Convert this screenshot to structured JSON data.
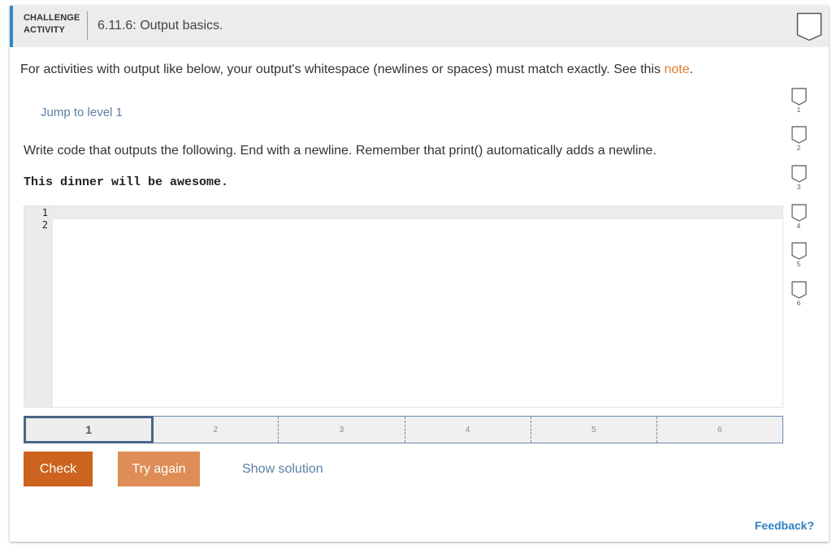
{
  "header": {
    "activity_type_line1": "CHALLENGE",
    "activity_type_line2": "ACTIVITY",
    "title": "6.11.6: Output basics.",
    "completion_badge_icon": "shield-outline-icon"
  },
  "instructions": {
    "text": "For activities with output like below, your output's whitespace (newlines or spaces) must match exactly. See this ",
    "link_label": "note",
    "trailing": "."
  },
  "jump_link": "Jump to level 1",
  "prompt": "Write code that outputs the following. End with a newline. Remember that print() automatically adds a newline.",
  "expected_output": "This dinner will be awesome.",
  "editor": {
    "line_numbers": [
      "1",
      "2"
    ],
    "code": ""
  },
  "levels": {
    "items": [
      "1",
      "2",
      "3",
      "4",
      "5",
      "6"
    ],
    "active": "1"
  },
  "buttons": {
    "check": "Check",
    "try_again": "Try again",
    "show_solution": "Show solution"
  },
  "feedback": "Feedback?",
  "level_badges": [
    "1",
    "2",
    "3",
    "4",
    "5",
    "6"
  ],
  "colors": {
    "accent_blue": "#2e88c8",
    "check_orange": "#cc631e",
    "try_again_orange": "#dd8d55",
    "link_orange": "#e07b2c",
    "link_blue": "#5a7fa6"
  }
}
